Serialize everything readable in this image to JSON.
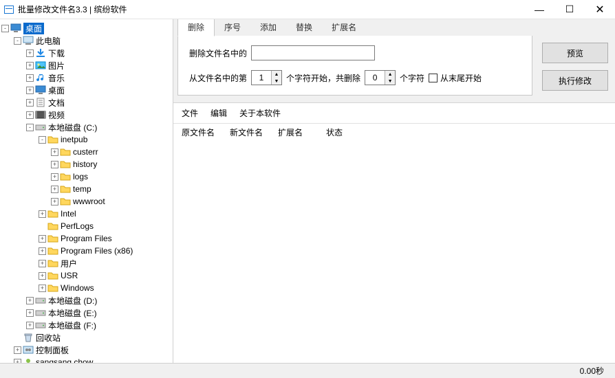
{
  "window": {
    "title": "批量修改文件名3.3 | 缤纷软件"
  },
  "tree": [
    {
      "d": 0,
      "e": "-",
      "i": "desktop",
      "t": "桌面",
      "sel": true
    },
    {
      "d": 1,
      "e": "-",
      "i": "pc",
      "t": "此电脑"
    },
    {
      "d": 2,
      "e": "+",
      "i": "dl",
      "t": "下载"
    },
    {
      "d": 2,
      "e": "+",
      "i": "pic",
      "t": "图片"
    },
    {
      "d": 2,
      "e": "+",
      "i": "music",
      "t": "音乐"
    },
    {
      "d": 2,
      "e": "+",
      "i": "desk2",
      "t": "桌面"
    },
    {
      "d": 2,
      "e": "+",
      "i": "doc",
      "t": "文档"
    },
    {
      "d": 2,
      "e": "+",
      "i": "vid",
      "t": "视频"
    },
    {
      "d": 2,
      "e": "-",
      "i": "drive",
      "t": "本地磁盘 (C:)"
    },
    {
      "d": 3,
      "e": "-",
      "i": "fld",
      "t": "inetpub"
    },
    {
      "d": 4,
      "e": "+",
      "i": "fld",
      "t": "custerr"
    },
    {
      "d": 4,
      "e": "+",
      "i": "fld",
      "t": "history"
    },
    {
      "d": 4,
      "e": "+",
      "i": "fld",
      "t": "logs"
    },
    {
      "d": 4,
      "e": "+",
      "i": "fld",
      "t": "temp"
    },
    {
      "d": 4,
      "e": "+",
      "i": "fld",
      "t": "wwwroot"
    },
    {
      "d": 3,
      "e": "+",
      "i": "fld",
      "t": "Intel"
    },
    {
      "d": 3,
      "e": "",
      "i": "fld",
      "t": "PerfLogs"
    },
    {
      "d": 3,
      "e": "+",
      "i": "fld",
      "t": "Program Files"
    },
    {
      "d": 3,
      "e": "+",
      "i": "fld",
      "t": "Program Files (x86)"
    },
    {
      "d": 3,
      "e": "+",
      "i": "fld",
      "t": "用户"
    },
    {
      "d": 3,
      "e": "+",
      "i": "fld",
      "t": "USR"
    },
    {
      "d": 3,
      "e": "+",
      "i": "fld",
      "t": "Windows"
    },
    {
      "d": 2,
      "e": "+",
      "i": "drive",
      "t": "本地磁盘 (D:)"
    },
    {
      "d": 2,
      "e": "+",
      "i": "drive",
      "t": "本地磁盘 (E:)"
    },
    {
      "d": 2,
      "e": "+",
      "i": "drive",
      "t": "本地磁盘 (F:)"
    },
    {
      "d": 1,
      "e": "",
      "i": "bin",
      "t": "回收站"
    },
    {
      "d": 1,
      "e": "+",
      "i": "cpl",
      "t": "控制面板"
    },
    {
      "d": 1,
      "e": "+",
      "i": "user",
      "t": "sangsang chow"
    }
  ],
  "tabs": [
    "删除",
    "序号",
    "添加",
    "替换",
    "扩展名"
  ],
  "active_tab": 0,
  "panel": {
    "row1_label": "删除文件名中的",
    "row1_value": "",
    "row2_a": "从文件名中的第",
    "spin1": "1",
    "row2_b": "个字符开始，共删除",
    "spin2": "0",
    "row2_c": "个字符",
    "chk_label": "从末尾开始",
    "chk_checked": false
  },
  "buttons": {
    "preview": "预览",
    "execute": "执行修改"
  },
  "menu2": [
    "文件",
    "编辑",
    "关于本软件"
  ],
  "table_headers": [
    "原文件名",
    "新文件名",
    "扩展名",
    "状态"
  ],
  "status": "0.00秒"
}
